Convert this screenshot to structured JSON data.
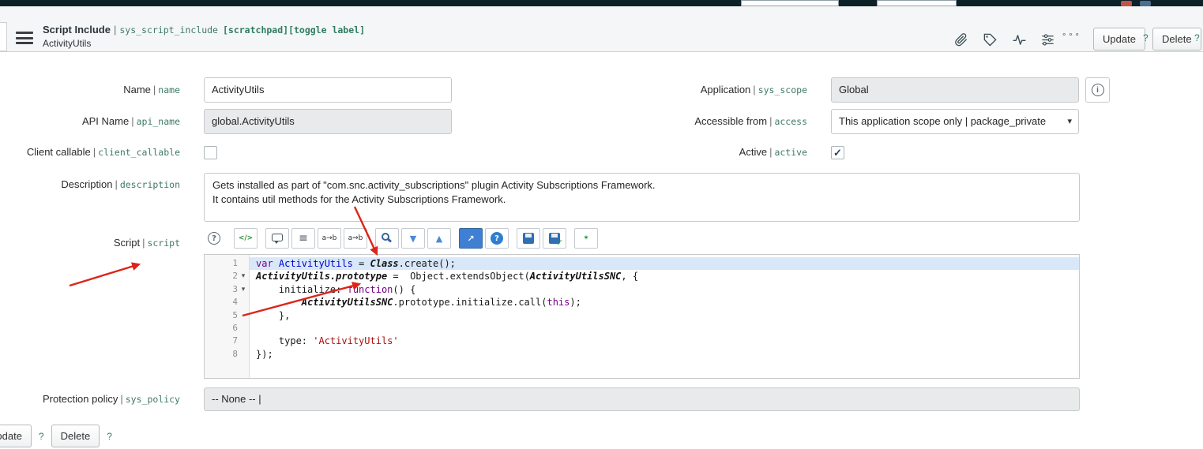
{
  "sep": "|",
  "icons": {
    "check": "✓",
    "chevron_down": "▾",
    "fold": "▾",
    "info": "i",
    "more_options": "∘∘∘"
  },
  "header": {
    "record_type": "Script Include",
    "table_name": "sys_script_include",
    "annotations": "[scratchpad][toggle label]",
    "record_name": "ActivityUtils",
    "update_label": "Update",
    "delete_label": "Delete",
    "help_text": "?"
  },
  "form": {
    "name": {
      "label": "Name",
      "tech": "name",
      "value": "ActivityUtils"
    },
    "api_name": {
      "label": "API Name",
      "tech": "api_name",
      "value": "global.ActivityUtils"
    },
    "client_callable": {
      "label": "Client callable",
      "tech": "client_callable",
      "checked": false
    },
    "description": {
      "label": "Description",
      "tech": "description",
      "value": "Gets installed as part of \"com.snc.activity_subscriptions\" plugin Activity Subscriptions Framework.\nIt contains util methods for the Activity Subscriptions Framework."
    },
    "script": {
      "label": "Script",
      "tech": "script"
    },
    "protection_policy": {
      "label": "Protection policy",
      "tech": "sys_policy",
      "value": "-- None -- |"
    },
    "application": {
      "label": "Application",
      "tech": "sys_scope",
      "value": "Global"
    },
    "accessible_from": {
      "label": "Accessible from",
      "tech": "access",
      "value": "This application scope only | package_private"
    },
    "active": {
      "label": "Active",
      "tech": "active",
      "checked": true
    }
  },
  "script_editor": {
    "active_line": 1,
    "fold_lines": [
      2,
      3
    ],
    "toolbar": [
      [
        {
          "name": "editor-help-icon",
          "glyph": "?",
          "variant": "plain-help"
        }
      ],
      [
        {
          "name": "script-syntax-icon",
          "glyph": "</>",
          "variant": "green-glyph"
        }
      ],
      [
        {
          "name": "toggle-comment-icon",
          "glyph": "",
          "variant": "bubble"
        },
        {
          "name": "format-code-icon",
          "glyph": "≡",
          "variant": "lines"
        },
        {
          "name": "replace-icon",
          "glyph": "a→b",
          "variant": "tiny"
        },
        {
          "name": "replace-all-icon",
          "glyph": "a⇒b",
          "variant": "tiny"
        }
      ],
      [
        {
          "name": "search-icon",
          "glyph": "",
          "variant": "magnifier"
        },
        {
          "name": "find-next-icon",
          "glyph": "▼",
          "variant": "blue-glyph"
        },
        {
          "name": "find-previous-icon",
          "glyph": "▲",
          "variant": "blue-glyph"
        }
      ],
      [
        {
          "name": "open-new-window-icon",
          "glyph": "↗",
          "variant": "blue-fill"
        },
        {
          "name": "help-circle-icon",
          "glyph": "?",
          "variant": "blue-circle"
        }
      ],
      [
        {
          "name": "save-icon",
          "glyph": "",
          "variant": "floppy"
        },
        {
          "name": "save-check-icon",
          "glyph": "",
          "variant": "floppy floppy-check"
        }
      ],
      [
        {
          "name": "debug-icon",
          "glyph": "✶",
          "variant": "green-glyph"
        }
      ]
    ],
    "lines": [
      {
        "n": 1,
        "tokens": [
          [
            "kw",
            "var "
          ],
          [
            "def",
            "ActivityUtils"
          ],
          [
            "pl",
            " = "
          ],
          [
            "gl",
            "Class"
          ],
          [
            "pl",
            ".create();"
          ]
        ]
      },
      {
        "n": 2,
        "tokens": [
          [
            "gl",
            "ActivityUtils.prototype"
          ],
          [
            "pl",
            " =  Object.extendsObject("
          ],
          [
            "gl",
            "ActivityUtilsSNC"
          ],
          [
            "pl",
            ", {"
          ]
        ]
      },
      {
        "n": 3,
        "tokens": [
          [
            "pl",
            "    initialize: "
          ],
          [
            "kw",
            "function"
          ],
          [
            "pl",
            "() {"
          ]
        ]
      },
      {
        "n": 4,
        "tokens": [
          [
            "pl",
            "        "
          ],
          [
            "gl",
            "ActivityUtilsSNC"
          ],
          [
            "pl",
            ".prototype.initialize.call("
          ],
          [
            "kw",
            "this"
          ],
          [
            "pl",
            ");"
          ]
        ]
      },
      {
        "n": 5,
        "tokens": [
          [
            "pl",
            "    },"
          ]
        ]
      },
      {
        "n": 6,
        "tokens": [
          [
            "pl",
            ""
          ]
        ]
      },
      {
        "n": 7,
        "tokens": [
          [
            "pl",
            "    type: "
          ],
          [
            "str",
            "'ActivityUtils'"
          ]
        ]
      },
      {
        "n": 8,
        "tokens": [
          [
            "pl",
            "});"
          ]
        ]
      }
    ]
  },
  "footer": {
    "update_label": "Update",
    "delete_label": "Delete",
    "help_text": "?"
  }
}
